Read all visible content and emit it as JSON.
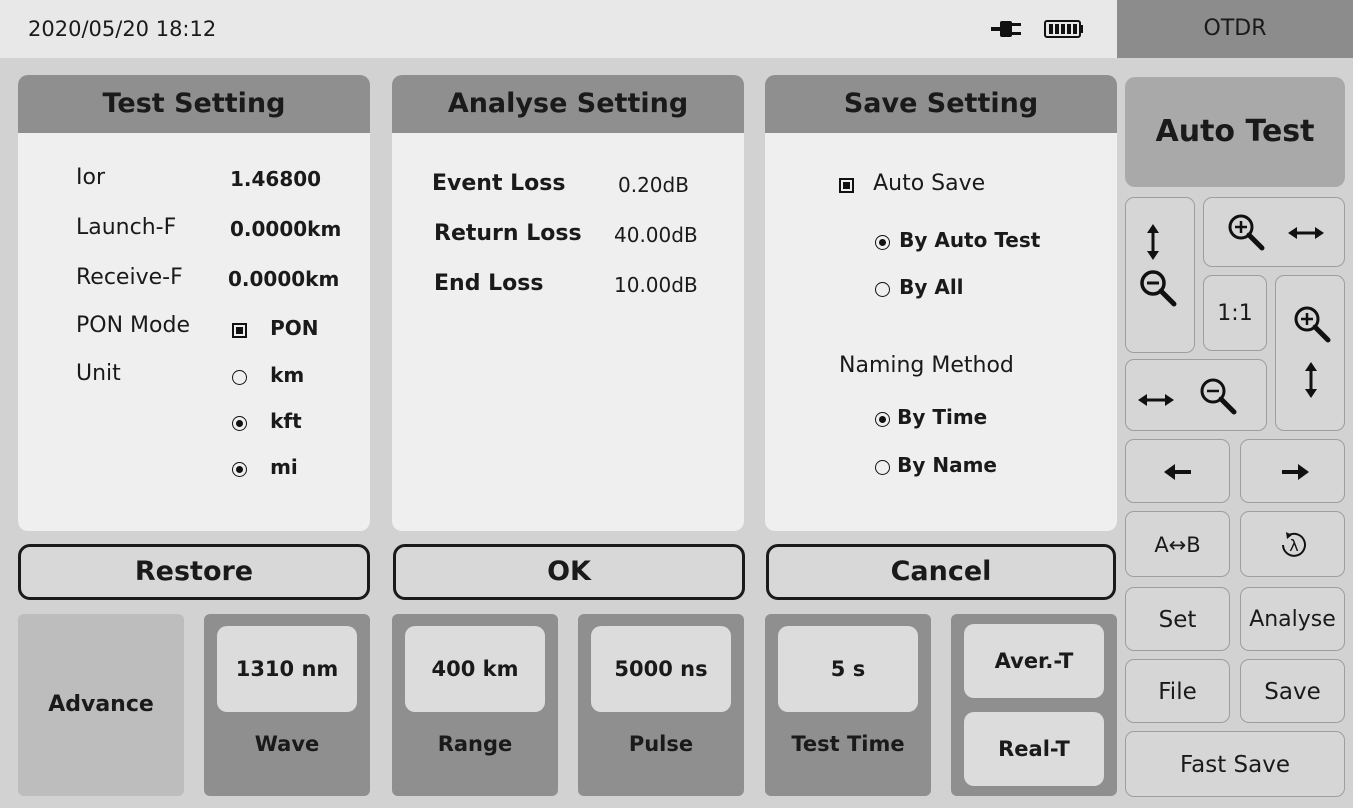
{
  "status": {
    "datetime": "2020/05/20  18:12",
    "mode": "OTDR",
    "icons": [
      "power-plug-icon",
      "battery-icon"
    ]
  },
  "test_setting": {
    "title": "Test Setting",
    "ior_label": "Ior",
    "ior_value": "1.46800",
    "launch_label": "Launch-F",
    "launch_value": "0.0000km",
    "receive_label": "Receive-F",
    "receive_value": "0.0000km",
    "pon_label": "PON Mode",
    "pon_value": "PON",
    "pon_checked": true,
    "unit_label": "Unit",
    "units": [
      {
        "label": "km",
        "selected": false
      },
      {
        "label": "kft",
        "selected": true
      },
      {
        "label": "mi",
        "selected": true
      }
    ]
  },
  "analyse_setting": {
    "title": "Analyse Setting",
    "event_loss_label": "Event Loss",
    "event_loss_value": "0.20dB",
    "return_loss_label": "Return Loss",
    "return_loss_value": "40.00dB",
    "end_loss_label": "End Loss",
    "end_loss_value": "10.00dB"
  },
  "save_setting": {
    "title": "Save Setting",
    "auto_save_label": "Auto Save",
    "auto_save_checked": true,
    "by_auto_test": "By Auto Test",
    "by_all": "By All",
    "auto_save_selected": "By Auto Test",
    "naming_label": "Naming Method",
    "by_time": "By Time",
    "by_name": "By Name",
    "naming_selected": "By Time"
  },
  "actions": {
    "restore": "Restore",
    "ok": "OK",
    "cancel": "Cancel"
  },
  "bottom": {
    "advance": "Advance",
    "wave_value": "1310 nm",
    "wave_label": "Wave",
    "range_value": "400 km",
    "range_label": "Range",
    "pulse_value": "5000 ns",
    "pulse_label": "Pulse",
    "time_value": "5 s",
    "time_label": "Test Time",
    "aver_t": "Aver.-T",
    "real_t": "Real-T"
  },
  "sidebar": {
    "auto_test": "Auto Test",
    "ratio": "1:1",
    "ab": "A↔B",
    "set": "Set",
    "analyse": "Analyse",
    "file": "File",
    "save": "Save",
    "fast_save": "Fast Save",
    "icons": [
      "vertical-zoom-out-icon",
      "horizontal-zoom-in-icon",
      "vertical-zoom-in-icon",
      "horizontal-zoom-out-icon",
      "arrow-left-icon",
      "arrow-right-icon",
      "wavelength-icon"
    ]
  }
}
